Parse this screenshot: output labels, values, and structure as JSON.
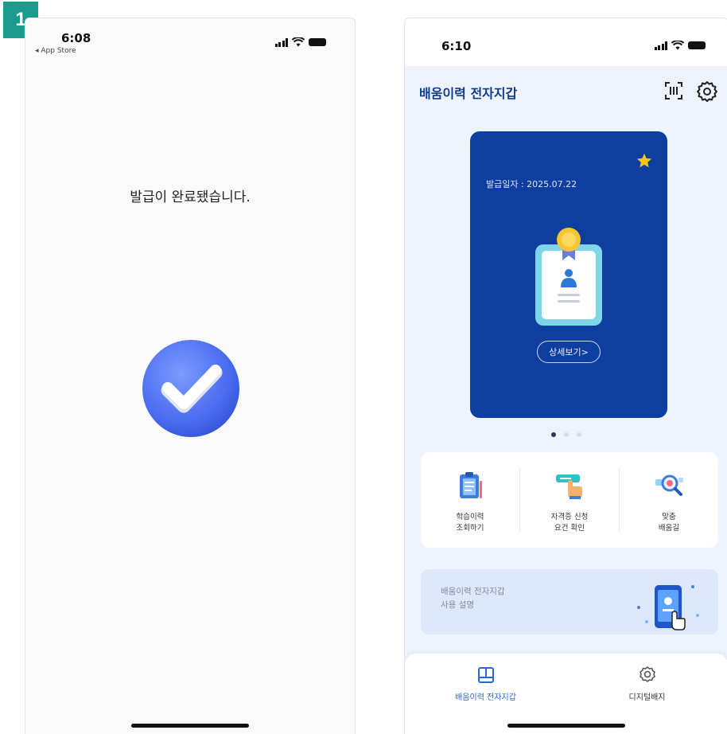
{
  "step_number": "1",
  "screen1": {
    "status_time": "6:08",
    "status_back": "◂ App Store",
    "message": "발급이 완료됐습니다."
  },
  "screen2": {
    "status_time": "6:10",
    "title": "배움이력 전자지갑",
    "card": {
      "issue_date": "발급일자 : 2025.07.22",
      "detail_button": "상세보기>"
    },
    "pager": {
      "count": 3,
      "active": 1
    },
    "menu": [
      {
        "label": "학습이력\n조회하기",
        "icon": "clipboard-icon"
      },
      {
        "label": "자격증 신청\n요건 확인",
        "icon": "tap-screen-icon"
      },
      {
        "label": "맞춤\n배움길",
        "icon": "magnify-icon"
      }
    ],
    "guide": {
      "text": "배움이력 전자지갑\n사용 설명"
    },
    "tabs": [
      {
        "label": "배움이력 전자지갑",
        "active": true
      },
      {
        "label": "디지털배지",
        "active": false
      }
    ],
    "colors": {
      "primary": "#0e3ea0",
      "accent": "#2a66d8",
      "title": "#123b8c"
    }
  }
}
